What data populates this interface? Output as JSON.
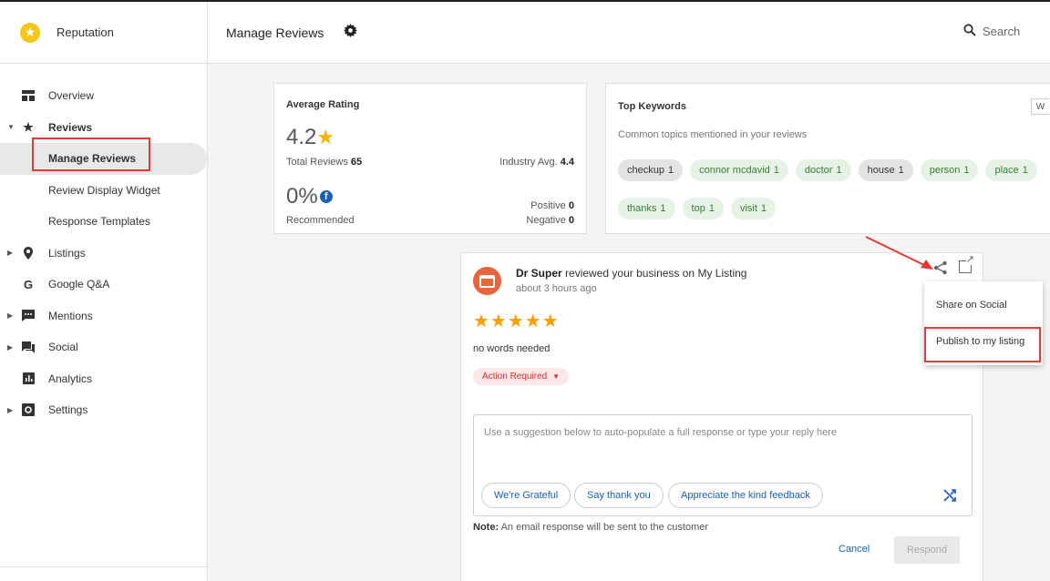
{
  "app": {
    "name": "Reputation"
  },
  "header": {
    "title": "Manage Reviews",
    "search_placeholder": "Search"
  },
  "sidebar": {
    "items": [
      {
        "label": "Overview"
      },
      {
        "label": "Reviews"
      },
      {
        "label": "Manage Reviews"
      },
      {
        "label": "Review Display Widget"
      },
      {
        "label": "Response Templates"
      },
      {
        "label": "Listings"
      },
      {
        "label": "Google Q&A"
      },
      {
        "label": "Mentions"
      },
      {
        "label": "Social"
      },
      {
        "label": "Analytics"
      },
      {
        "label": "Settings"
      }
    ]
  },
  "avg_rating": {
    "title": "Average Rating",
    "value": "4.2",
    "total_label": "Total Reviews",
    "total": "65",
    "industry_label": "Industry Avg.",
    "industry": "4.4",
    "recommended_value": "0%",
    "recommended_label": "Recommended",
    "positive_label": "Positive",
    "positive": "0",
    "negative_label": "Negative",
    "negative": "0"
  },
  "keywords": {
    "title": "Top Keywords",
    "subtitle": "Common topics mentioned in your reviews",
    "side_button": "W",
    "chips": [
      {
        "word": "checkup",
        "count": "1",
        "tone": "grey"
      },
      {
        "word": "connor mcdavid",
        "count": "1",
        "tone": "green"
      },
      {
        "word": "doctor",
        "count": "1",
        "tone": "green"
      },
      {
        "word": "house",
        "count": "1",
        "tone": "grey"
      },
      {
        "word": "person",
        "count": "1",
        "tone": "green"
      },
      {
        "word": "place",
        "count": "1",
        "tone": "green"
      },
      {
        "word": "thanks",
        "count": "1",
        "tone": "green"
      },
      {
        "word": "top",
        "count": "1",
        "tone": "green"
      },
      {
        "word": "visit",
        "count": "1",
        "tone": "green"
      }
    ]
  },
  "review": {
    "reviewer": "Dr Super",
    "action_text": "reviewed your business on My Listing",
    "time": "about 3 hours ago",
    "stars": "★★★★★",
    "text": "no words needed",
    "badge": "Action Required",
    "reply_placeholder": "Use a suggestion below to auto-populate a full response or type your reply here",
    "suggestions": [
      "We're Grateful",
      "Say thank you",
      "Appreciate the kind feedback"
    ],
    "note_label": "Note:",
    "note_text": "An email response will be sent to the customer",
    "cancel": "Cancel",
    "respond": "Respond"
  },
  "share_menu": {
    "items": [
      "Share on Social",
      "Publish to my listing"
    ]
  },
  "colors": {
    "accent": "#1a5fb4",
    "star": "#f5b400",
    "highlight": "#e53935"
  }
}
